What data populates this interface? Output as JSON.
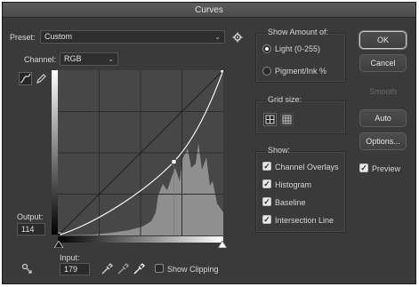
{
  "title": "Curves",
  "preset": {
    "label": "Preset:",
    "value": "Custom"
  },
  "channel": {
    "label": "Channel:",
    "value": "RGB"
  },
  "output": {
    "label": "Output:",
    "value": "114"
  },
  "input": {
    "label": "Input:",
    "value": "179"
  },
  "show_clipping_label": "Show Clipping",
  "show_amount": {
    "title": "Show Amount of:",
    "options": [
      {
        "label": "Light  (0-255)",
        "selected": true
      },
      {
        "label": "Pigment/Ink %",
        "selected": false
      }
    ]
  },
  "grid_size": {
    "title": "Grid size:"
  },
  "show": {
    "title": "Show:",
    "items": [
      {
        "label": "Channel Overlays",
        "checked": true
      },
      {
        "label": "Histogram",
        "checked": true
      },
      {
        "label": "Baseline",
        "checked": true
      },
      {
        "label": "Intersection Line",
        "checked": true
      }
    ]
  },
  "buttons": {
    "ok": "OK",
    "cancel": "Cancel",
    "smooth": "Smooth",
    "auto": "Auto",
    "options": "Options..."
  },
  "preview": {
    "label": "Preview",
    "checked": true
  },
  "curve": {
    "input_points": [
      0,
      179,
      255
    ],
    "output_points": [
      0,
      114,
      255
    ]
  },
  "colors": {
    "dialog_bg": "#3a3a3a",
    "graph_bg": "#474747",
    "histogram": "#8f8f8f",
    "curve": "#ffffff"
  },
  "icons": [
    "curve-tool-icon",
    "pencil-icon",
    "gear-icon",
    "black-eyedropper-icon",
    "gray-eyedropper-icon",
    "white-eyedropper-icon",
    "target-adjust-icon"
  ]
}
